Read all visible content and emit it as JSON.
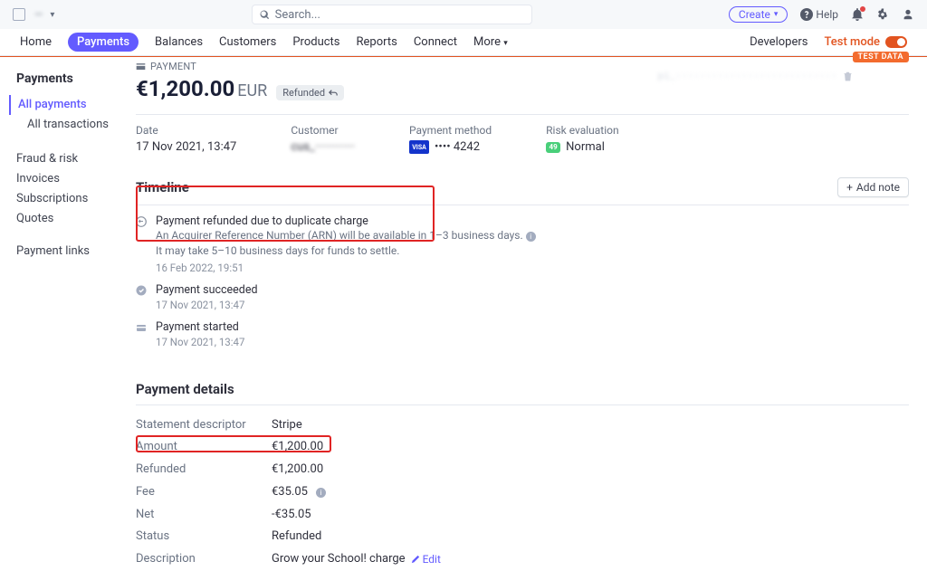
{
  "topbar": {
    "account_name": "—",
    "search_placeholder": "Search...",
    "create_label": "Create",
    "help_label": "Help"
  },
  "nav": {
    "home": "Home",
    "payments": "Payments",
    "balances": "Balances",
    "customers": "Customers",
    "products": "Products",
    "reports": "Reports",
    "connect": "Connect",
    "more": "More",
    "developers": "Developers",
    "test_mode": "Test mode"
  },
  "sidebar": {
    "title": "Payments",
    "all_payments": "All payments",
    "all_transactions": "All transactions",
    "fraud": "Fraud & risk",
    "invoices": "Invoices",
    "subscriptions": "Subscriptions",
    "quotes": "Quotes",
    "payment_links": "Payment links"
  },
  "header": {
    "crumb": "PAYMENT",
    "test_data_badge": "TEST DATA",
    "amount": "€1,200.00",
    "currency": "EUR",
    "refunded_badge": "Refunded",
    "payment_id": "pi_···························"
  },
  "summary": {
    "date_label": "Date",
    "date_value": "17 Nov 2021, 13:47",
    "customer_label": "Customer",
    "customer_value": "cus_·············",
    "method_label": "Payment method",
    "method_value": "•••• 4242",
    "risk_label": "Risk evaluation",
    "risk_score": "49",
    "risk_value": "Normal"
  },
  "timeline": {
    "title": "Timeline",
    "add_note": "Add note",
    "items": [
      {
        "title": "Payment refunded due to duplicate charge",
        "sub1": "An Acquirer Reference Number (ARN) will be available in 1–3 business days.",
        "sub2": "It may take 5–10 business days for funds to settle.",
        "time": "16 Feb 2022, 19:51"
      },
      {
        "title": "Payment succeeded",
        "time": "17 Nov 2021, 13:47"
      },
      {
        "title": "Payment started",
        "time": "17 Nov 2021, 13:47"
      }
    ]
  },
  "details": {
    "title": "Payment details",
    "rows": {
      "statement_k": "Statement descriptor",
      "statement_v": "Stripe",
      "amount_k": "Amount",
      "amount_v": "€1,200.00",
      "refunded_k": "Refunded",
      "refunded_v": "€1,200.00",
      "fee_k": "Fee",
      "fee_v": "€35.05",
      "net_k": "Net",
      "net_v": "-€35.05",
      "status_k": "Status",
      "status_v": "Refunded",
      "description_k": "Description",
      "description_v": "Grow your School! charge"
    },
    "edit_label": "Edit"
  }
}
